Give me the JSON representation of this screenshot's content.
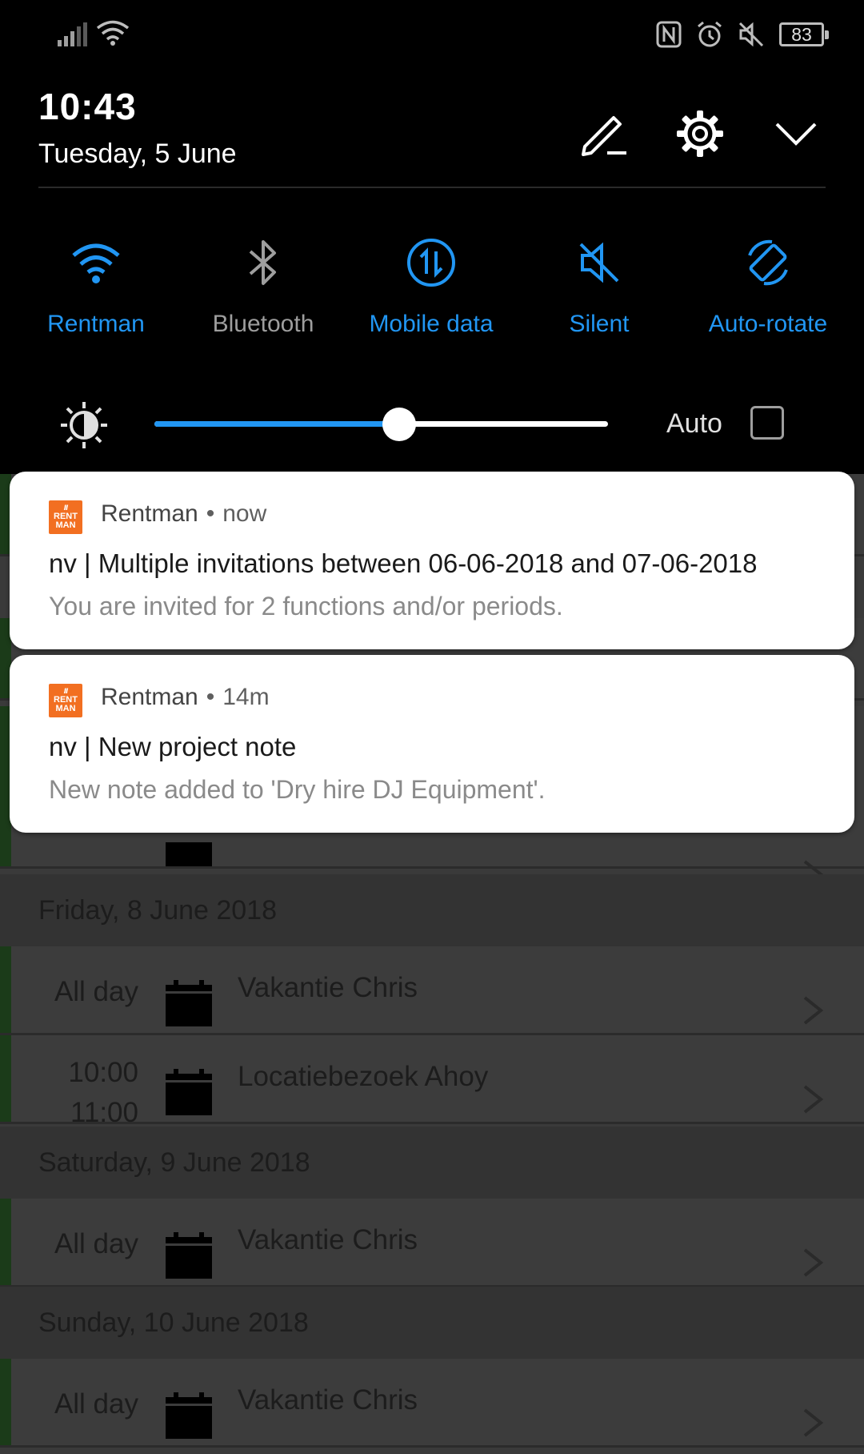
{
  "status_bar": {
    "battery_level": "83",
    "left_icons": [
      "signal-icon",
      "wifi-icon"
    ],
    "right_icons": [
      "nfc-icon",
      "alarm-icon",
      "mute-icon",
      "battery-icon"
    ]
  },
  "header": {
    "time": "10:43",
    "date": "Tuesday, 5 June",
    "buttons": [
      "edit-icon",
      "gear-icon",
      "chevron-down-icon"
    ]
  },
  "quick_tiles": [
    {
      "label": "Rentman",
      "icon": "wifi-icon",
      "active": true
    },
    {
      "label": "Bluetooth",
      "icon": "bluetooth-icon",
      "active": false
    },
    {
      "label": "Mobile data",
      "icon": "mobile-data-icon",
      "active": true
    },
    {
      "label": "Silent",
      "icon": "silent-icon",
      "active": true
    },
    {
      "label": "Auto-rotate",
      "icon": "auto-rotate-icon",
      "active": true
    }
  ],
  "brightness": {
    "level": 0.54,
    "auto_label": "Auto",
    "auto_checked": false
  },
  "notifications": [
    {
      "app": "Rentman",
      "time": "now",
      "title": "nv | Multiple invitations between 06-06-2018 and 07-06-2018",
      "text": "You are invited for 2 functions and/or periods."
    },
    {
      "app": "Rentman",
      "time": "14m",
      "title": "nv | New project note",
      "text": "New note added to 'Dry hire DJ Equipment'."
    }
  ],
  "background_app": {
    "days": [
      {
        "label": "Friday, 8 June 2018",
        "events": [
          {
            "start": "All day",
            "end": "",
            "title": "Vakantie Chris"
          },
          {
            "start": "10:00",
            "end": "11:00",
            "title": "Locatiebezoek Ahoy"
          }
        ]
      },
      {
        "label": "Saturday, 9 June 2018",
        "events": [
          {
            "start": "All day",
            "end": "",
            "title": "Vakantie Chris"
          }
        ]
      },
      {
        "label": "Sunday, 10 June 2018",
        "events": [
          {
            "start": "All day",
            "end": "",
            "title": "Vakantie Chris"
          }
        ]
      }
    ]
  },
  "colors": {
    "accent": "#2196f3",
    "shade_bg": "#000000",
    "notification_bg": "#ffffff",
    "app_icon": "#f26f21"
  }
}
